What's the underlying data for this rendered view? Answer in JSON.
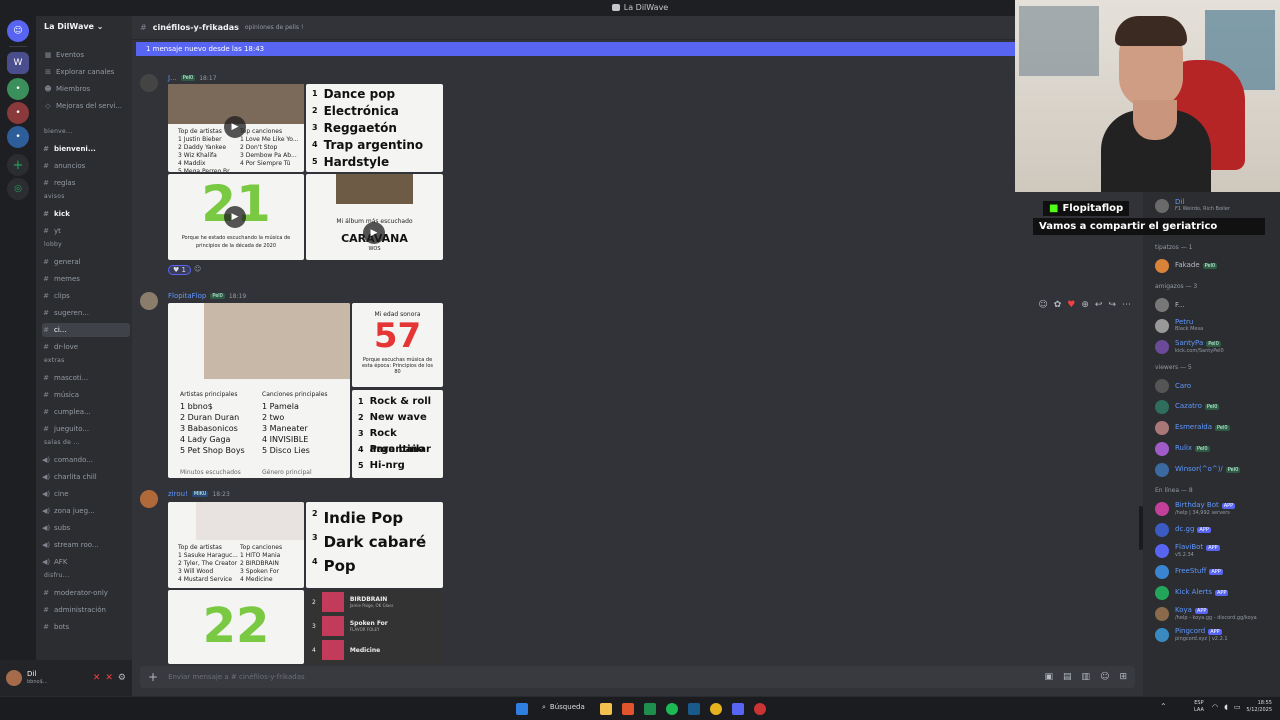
{
  "window": {
    "title": "La DilWave"
  },
  "server": {
    "name": "La DilWave"
  },
  "channels": {
    "top": [
      {
        "label": "Eventos"
      },
      {
        "label": "Explorar canales"
      },
      {
        "label": "Miembros"
      },
      {
        "label": "Mejoras del servi..."
      }
    ],
    "items": [
      {
        "cat": "bienve...",
        "label": "bienveni...",
        "type": "text"
      },
      {
        "label": "anuncios",
        "type": "text"
      },
      {
        "label": "reglas",
        "type": "text"
      },
      {
        "cat": "avisos",
        "label": "kick",
        "type": "text"
      },
      {
        "label": "yt",
        "type": "text"
      },
      {
        "cat": "lobby",
        "label": "general",
        "type": "text"
      },
      {
        "label": "memes",
        "type": "text"
      },
      {
        "label": "clips",
        "type": "text"
      },
      {
        "label": "sugeren...",
        "type": "text"
      },
      {
        "label": "ci...",
        "type": "text"
      },
      {
        "label": "dr-love",
        "type": "text"
      },
      {
        "cat": "extras",
        "label": "mascoti...",
        "type": "text"
      },
      {
        "label": "música",
        "type": "text"
      },
      {
        "label": "cumplea...",
        "type": "text"
      },
      {
        "label": "jueguito...",
        "type": "text"
      },
      {
        "cat": "salas de ...",
        "label": "comando...",
        "type": "voice"
      },
      {
        "label": "charlita chill",
        "type": "voice"
      },
      {
        "label": "cine",
        "type": "voice"
      },
      {
        "label": "zona jueg...",
        "type": "voice"
      },
      {
        "label": "subs",
        "type": "voice"
      },
      {
        "label": "stream roo...",
        "type": "voice"
      },
      {
        "label": "AFK",
        "type": "voice"
      },
      {
        "cat": "disfru...",
        "label": "moderator-only",
        "type": "text"
      },
      {
        "label": "administración",
        "type": "text"
      },
      {
        "label": "bots",
        "type": "text"
      }
    ]
  },
  "user": {
    "name": "Dil",
    "status": "bbno$..."
  },
  "chat": {
    "channel_title": "cinéfilos-y-frikadas",
    "topic": "opiniones de pelis !",
    "new_banner": "1 mensaje nuevo desde las 18:43",
    "composer_placeholder": "Enviar mensaje a #  cinéfilos-y-frikadas",
    "messages": [
      {
        "author": "J...",
        "tag": "Pel0",
        "time": "18:17",
        "genres": [
          {
            "n": "1",
            "g": "Dance pop"
          },
          {
            "n": "2",
            "g": "Electrónica"
          },
          {
            "n": "3",
            "g": "Reggaetón"
          },
          {
            "n": "4",
            "g": "Trap argentino"
          },
          {
            "n": "5",
            "g": "Hardstyle"
          }
        ],
        "artists_head": "Top de artistas",
        "songs_head": "Top canciones",
        "artists": [
          "1 Justin Bieber",
          "2 Daddy Yankee",
          "3 Wiz Khalifa",
          "4 Maddix",
          "5 Mega Perreo Br..."
        ],
        "songs": [
          "1 Love Me Like Yo...",
          "2 Don't Stop",
          "3 Dembow Pa Ab...",
          "4 Por Siempre Tú"
        ],
        "decade_num": "21",
        "decade_text": "Porque he estado escuchando la música de principios de la década de 2020",
        "album_label": "Mi álbum más escuchado",
        "album": "CARAVANA",
        "album_artist": "WOS",
        "reaction_count": "1"
      },
      {
        "author": "FlopitaFlop",
        "tag": "Pel0",
        "time": "18:19",
        "age_label": "Mi edad sonora",
        "age": "57",
        "age_text": "Porque escuchas música de esta época: Principios de los 80",
        "artists_head": "Artistas principales",
        "songs_head": "Canciones principales",
        "artists": [
          "1 bbno$",
          "2 Duran Duran",
          "3 Babasonicos",
          "4 Lady Gaga",
          "5 Pet Shop Boys"
        ],
        "songs": [
          "1 Pamela",
          "2 two",
          "3 Maneater",
          "4 INVISIBLE",
          "5 Disco Lies"
        ],
        "footer_left": "Minutos escuchados",
        "footer_right": "Género principal",
        "genres": [
          {
            "n": "1",
            "g": "Rock & roll"
          },
          {
            "n": "2",
            "g": "New wave"
          },
          {
            "n": "3",
            "g": "Rock argentino"
          },
          {
            "n": "4",
            "g": "Para bailar"
          },
          {
            "n": "5",
            "g": "Hi-nrg"
          }
        ]
      },
      {
        "author": "zirou!",
        "tag": "MIKU",
        "time": "18:23",
        "genres": [
          {
            "n": "2",
            "g": "Indie Pop"
          },
          {
            "n": "3",
            "g": "Dark cabaré"
          },
          {
            "n": "4",
            "g": "Pop"
          }
        ],
        "artists_head": "Top de artistas",
        "songs_head": "Top canciones",
        "artists": [
          "1 Sasuke Haraguc...",
          "2 Tyler, The Creator",
          "3 Will Wood",
          "4 Mustard Service"
        ],
        "songs": [
          "1 HITO Mania",
          "2 BIRDBRAIN",
          "3 Spoken For",
          "4 Medicine"
        ],
        "decade_num": "22",
        "tracks": [
          {
            "n": "2",
            "t": "BIRDBRAIN",
            "a": "Jamie Paige, OK Glass"
          },
          {
            "n": "3",
            "t": "Spoken For",
            "a": "FLAVOR FOLEY"
          },
          {
            "n": "4",
            "t": "Medicine",
            "a": ""
          }
        ]
      }
    ]
  },
  "stream_overlay": {
    "name": "Flopitaflop",
    "message": "Vamos a compartir el geriatrico"
  },
  "members": {
    "list": [
      {
        "cat": "",
        "name": "Dil",
        "sub": "F1 Weirdo, Rich Boiler",
        "color": "#5e98ff"
      },
      {
        "cat": "",
        "name": "zirou!",
        "tag": "MIKU",
        "color": "#5e98ff"
      },
      {
        "cat": "tipatzos — 1",
        "name": "Fakade",
        "tag": "Pel0",
        "color": "#b5bac1"
      },
      {
        "cat": "amigazos — 3",
        "name": "F...",
        "color": "#b5bac1"
      },
      {
        "name": "Petru",
        "sub": "Black Mesa",
        "color": "#5e98ff"
      },
      {
        "name": "SantyPa",
        "tag": "Pel0",
        "sub": "kick.com/SantyPel0",
        "color": "#5e98ff"
      },
      {
        "cat": "viewers — 5",
        "name": "Caro",
        "color": "#5e98ff"
      },
      {
        "name": "Cazatro",
        "tag": "Pel0",
        "color": "#5e98ff"
      },
      {
        "name": "Esmeralda",
        "tag": "Pel0",
        "color": "#5e98ff"
      },
      {
        "name": "Rulix",
        "tag": "Pel0",
        "color": "#5e98ff"
      },
      {
        "name": "Winsor(^o^)/",
        "tag": "Pel0",
        "color": "#5e98ff"
      },
      {
        "cat": "En línea — 8",
        "name": "Birthday Bot",
        "app": "APP",
        "sub": "/help | 34,992 servers",
        "color": "#5e98ff"
      },
      {
        "name": "dc.gg",
        "app": "APP",
        "color": "#5e98ff"
      },
      {
        "name": "FlaviBot",
        "app": "APP",
        "sub": "v5.2.34",
        "color": "#5e98ff"
      },
      {
        "name": "FreeStuff",
        "app": "APP",
        "color": "#5e98ff"
      },
      {
        "name": "Kick Alerts",
        "app": "APP",
        "color": "#5e98ff"
      },
      {
        "name": "Koya",
        "app": "APP",
        "sub": "/help - koya.gg - discord.gg/koya",
        "color": "#5e98ff"
      },
      {
        "name": "Pingcord",
        "app": "APP",
        "sub": "pingcord.xyz | v2.2.1",
        "color": "#5e98ff"
      }
    ]
  },
  "taskbar": {
    "search": "Búsqueda",
    "lang": "ESP",
    "lang2": "LAA",
    "time": "18:55",
    "date": "5/12/2025"
  }
}
